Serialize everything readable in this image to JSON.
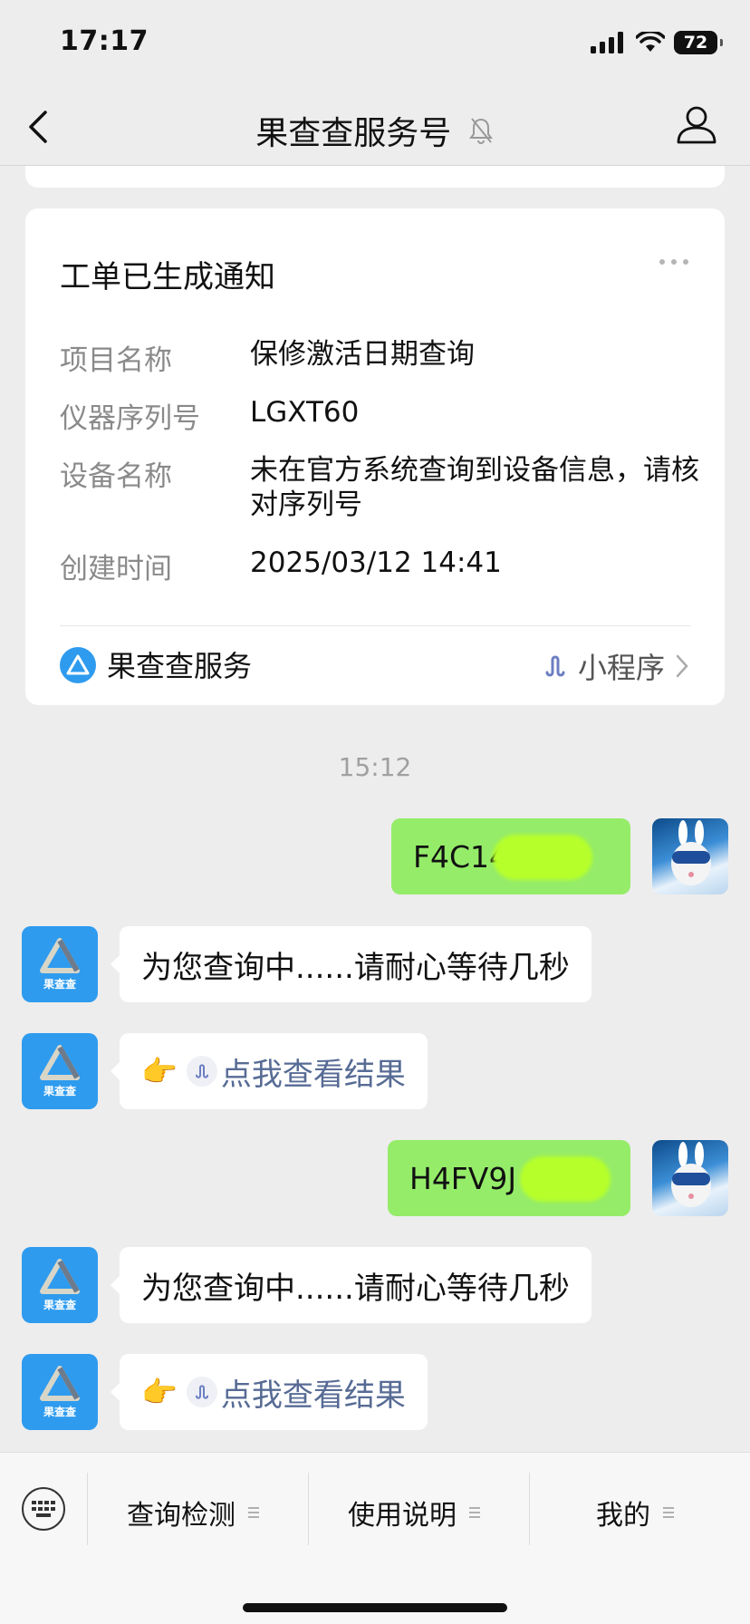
{
  "status_bar": {
    "time": "17:17",
    "battery": "72"
  },
  "nav": {
    "title": "果查查服务号"
  },
  "card": {
    "title": "工单已生成通知",
    "rows": [
      {
        "label": "项目名称",
        "value": "保修激活日期查询"
      },
      {
        "label": "仪器序列号",
        "value": "LGXT60"
      },
      {
        "label": "设备名称",
        "value": "未在官方系统查询到设备信息，请核对序列号"
      },
      {
        "label": "创建时间",
        "value": "2025/03/12 14:41"
      }
    ],
    "footer_name": "果查查服务",
    "footer_type": "小程序"
  },
  "timestamp": "15:12",
  "messages": [
    {
      "from": "user",
      "text": "F4C14"
    },
    {
      "from": "bot",
      "text": "为您查询中......请耐心等待几秒"
    },
    {
      "from": "bot",
      "link": "点我查看结果"
    },
    {
      "from": "user",
      "text": "H4FV9J"
    },
    {
      "from": "bot",
      "text": "为您查询中......请耐心等待几秒"
    },
    {
      "from": "bot",
      "link": "点我查看结果"
    }
  ],
  "bot_avatar_label": "果查查",
  "menu": [
    {
      "label": "查询检测"
    },
    {
      "label": "使用说明"
    },
    {
      "label": "我的"
    }
  ],
  "colors": {
    "outgoing_bubble": "#95ec69",
    "link": "#576b95",
    "bot_avatar": "#2e9bef"
  }
}
